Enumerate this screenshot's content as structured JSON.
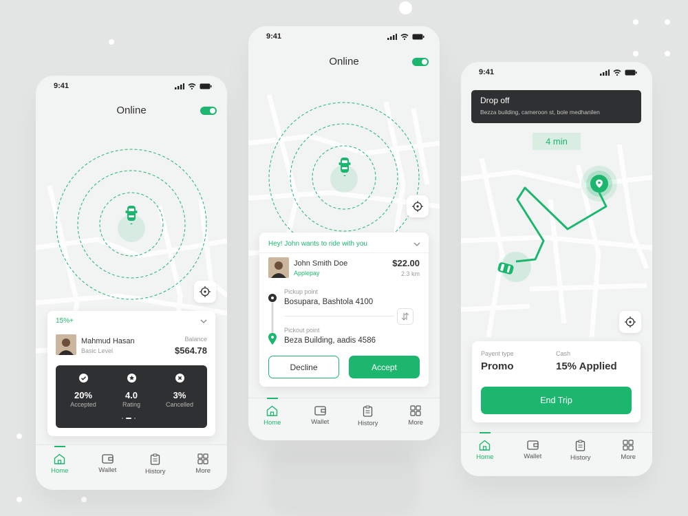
{
  "colors": {
    "accent": "#1db66f",
    "dark_card": "#2f3031",
    "background": "#e4e5e5"
  },
  "phone1": {
    "status_time": "9:41",
    "title": "Online",
    "card": {
      "badge": "15%+",
      "driver_name": "Mahmud Hasan",
      "driver_level": "Basic Level",
      "balance_label": "Balance",
      "balance_value": "$564.78",
      "stats": [
        {
          "value": "20%",
          "label": "Accepted",
          "icon": "check-circle-icon"
        },
        {
          "value": "4.0",
          "label": "Rating",
          "icon": "star-circle-icon"
        },
        {
          "value": "3%",
          "label": "Cancelled",
          "icon": "x-circle-icon"
        }
      ]
    },
    "tabs": [
      "Home",
      "Wallet",
      "History",
      "More"
    ]
  },
  "phone2": {
    "status_time": "9:41",
    "title": "Online",
    "request": {
      "heading": "Hey! John wants to ride with you",
      "rider_name": "John Smith Doe",
      "payment": "Applepay",
      "price": "$22.00",
      "distance": "2.3 km",
      "pickup_label": "Pickup point",
      "pickup_value": "Bosupara, Bashtola 4100",
      "dropoff_label": "Pickout point",
      "dropoff_value": "Beza Building, aadis 4586",
      "decline": "Decline",
      "accept": "Accept"
    },
    "tabs": [
      "Home",
      "Wallet",
      "History",
      "More"
    ]
  },
  "phone3": {
    "status_time": "9:41",
    "dropoff_title": "Drop off",
    "dropoff_address": "Bezza building, cameroon st, bole medhanilen",
    "eta": "4 min",
    "payment_type_label": "Payent type",
    "payment_type_value": "Promo",
    "cash_label": "Cash",
    "cash_value": "15% Applied",
    "end_trip": "End Trip",
    "tabs": [
      "Home",
      "Wallet",
      "History",
      "More"
    ]
  }
}
